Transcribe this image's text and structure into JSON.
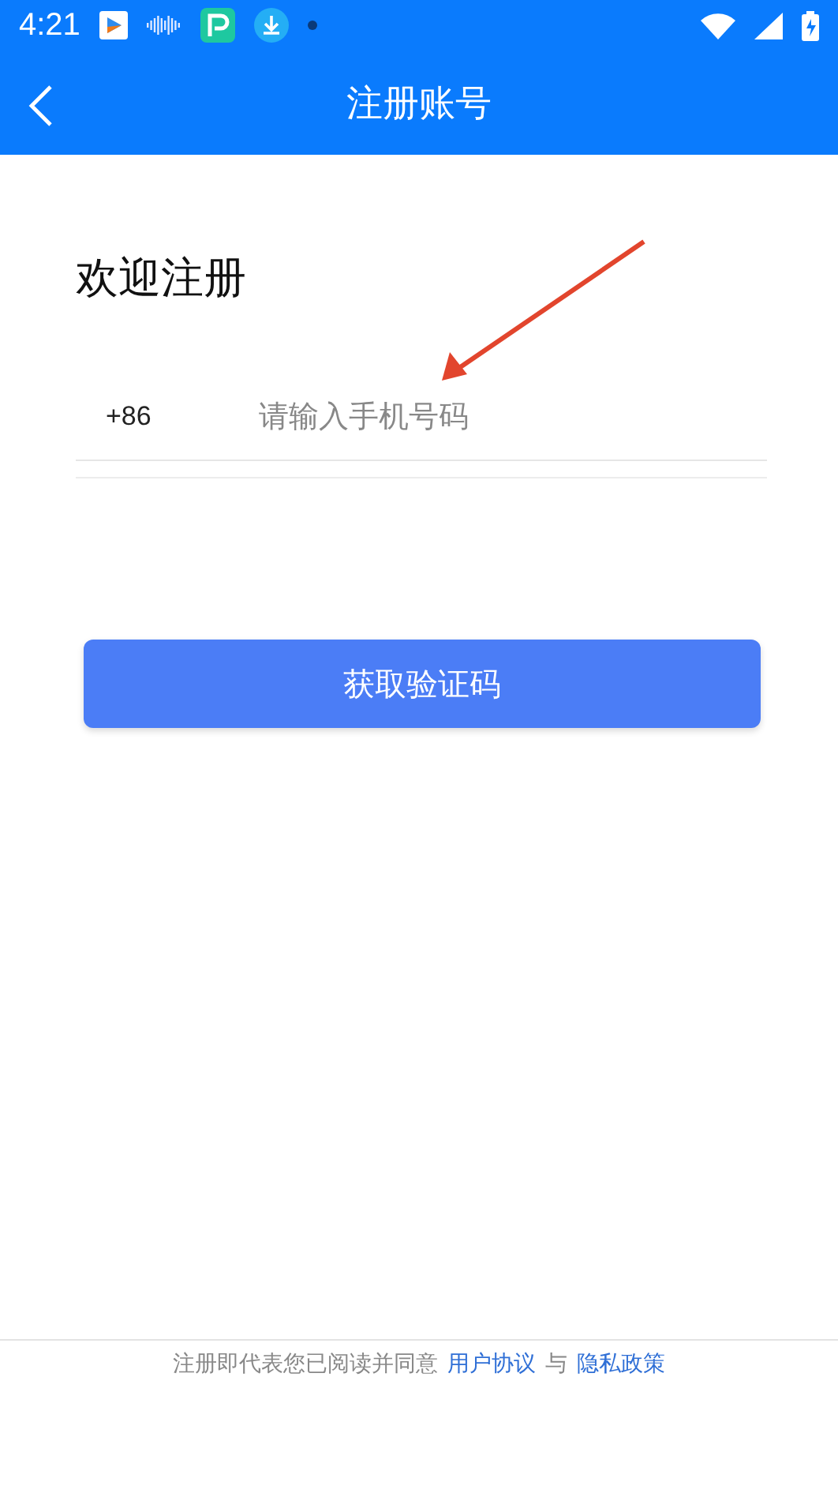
{
  "status_bar": {
    "time": "4:21"
  },
  "app_bar": {
    "title": "注册账号"
  },
  "heading": "欢迎注册",
  "phone": {
    "country_code": "+86",
    "placeholder": "请输入手机号码"
  },
  "submit_button": "获取验证码",
  "footer": {
    "text": "注册即代表您已阅读并同意",
    "link_1": "用户协议",
    "joiner": "与",
    "link_2": "隐私政策"
  }
}
